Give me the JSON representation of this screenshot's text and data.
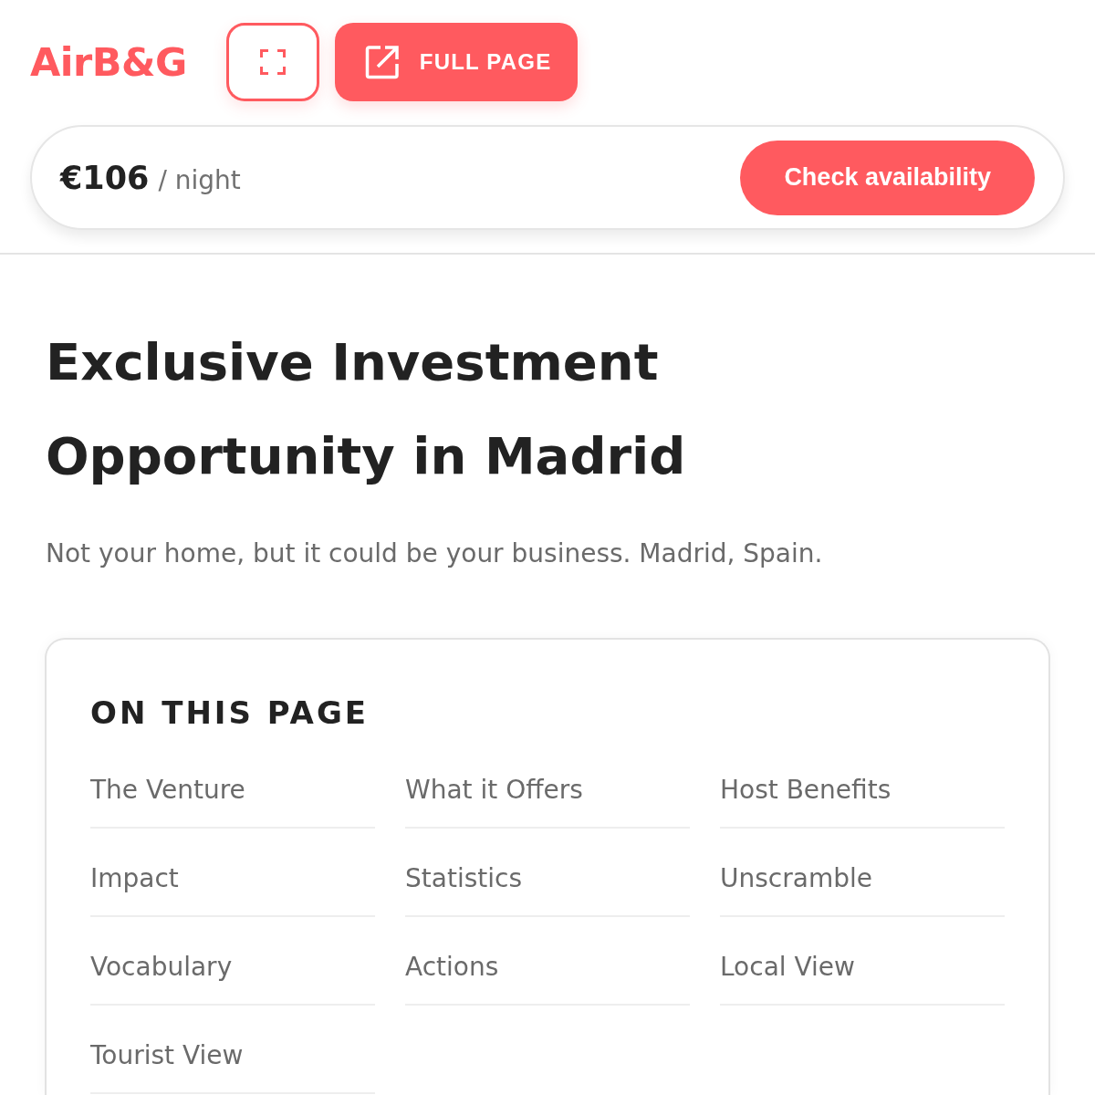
{
  "header": {
    "logo": "AirB&G",
    "buttons": [
      {
        "kind": "outline"
      },
      {
        "kind": "filled",
        "label": "FULL PAGE"
      }
    ]
  },
  "booking_bar": {
    "price": "€106",
    "unit": "/ night",
    "button": "Check availability"
  },
  "title": "Exclusive Investment Opportunity in Madrid",
  "subtitle": "Not your home, but it could be your business. Madrid, Spain.",
  "toc": {
    "heading": "ON THIS PAGE",
    "items": [
      "The Venture",
      "What it Offers",
      "Host Benefits",
      "Impact",
      "Statistics",
      "Unscramble",
      "Vocabulary",
      "Actions",
      "Local View",
      "Tourist View"
    ]
  }
}
